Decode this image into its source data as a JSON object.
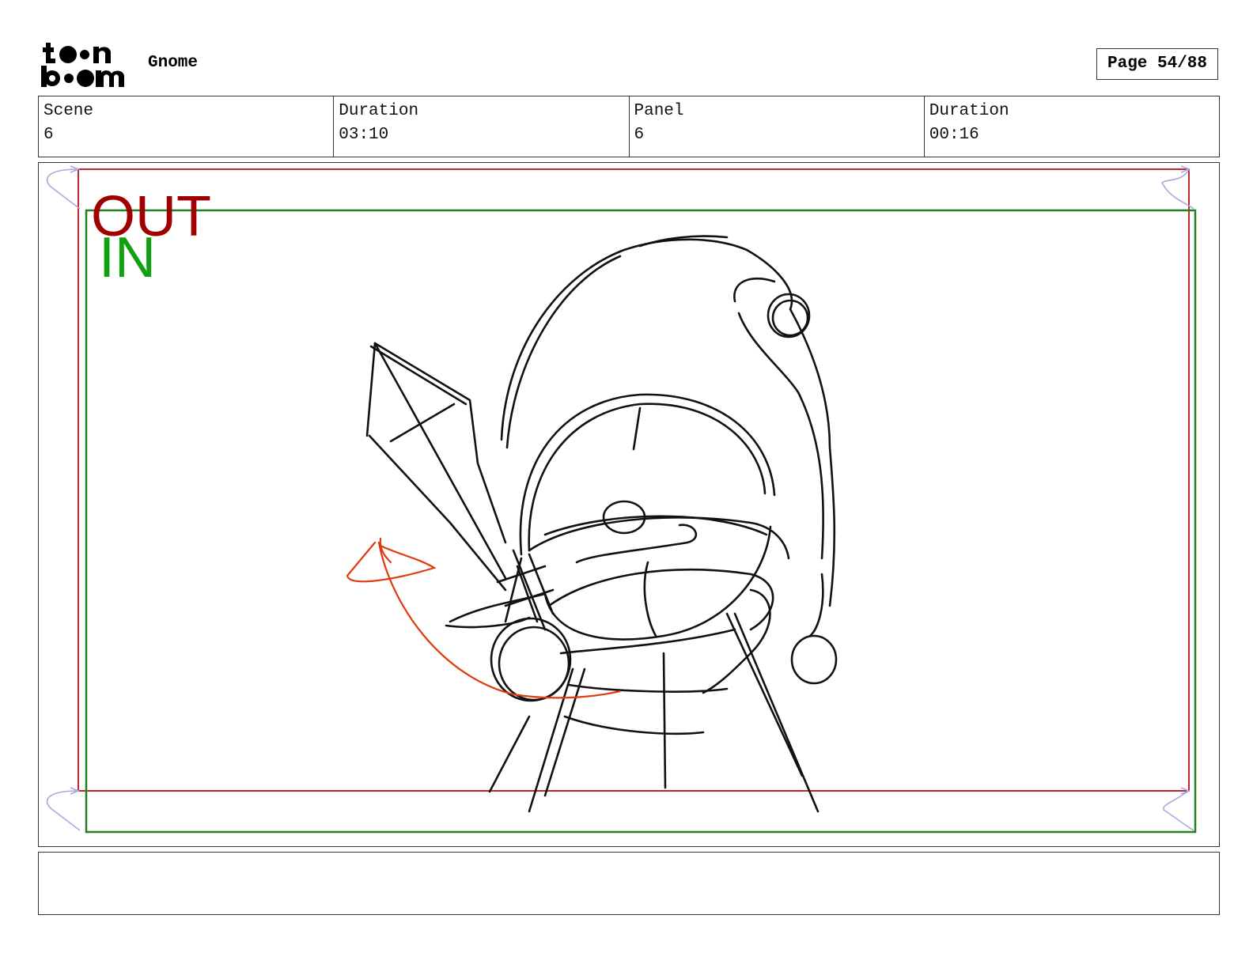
{
  "logo": {
    "text_top": "toon",
    "text_bottom": "boom"
  },
  "project": {
    "title": "Gnome"
  },
  "page": {
    "label": "Page 54/88"
  },
  "info": [
    {
      "label": "Scene",
      "value": "6"
    },
    {
      "label": "Duration",
      "value": "03:10"
    },
    {
      "label": "Panel",
      "value": "6"
    },
    {
      "label": "Duration",
      "value": "00:16"
    }
  ],
  "camera": {
    "out_label": "OUT",
    "in_label": "IN",
    "out_color": "#a00000",
    "in_color": "#11a011"
  },
  "drawing": {
    "subject": "gnome-sketch-icon",
    "arrow_color": "#e03a10"
  },
  "notes": {
    "text": ""
  }
}
